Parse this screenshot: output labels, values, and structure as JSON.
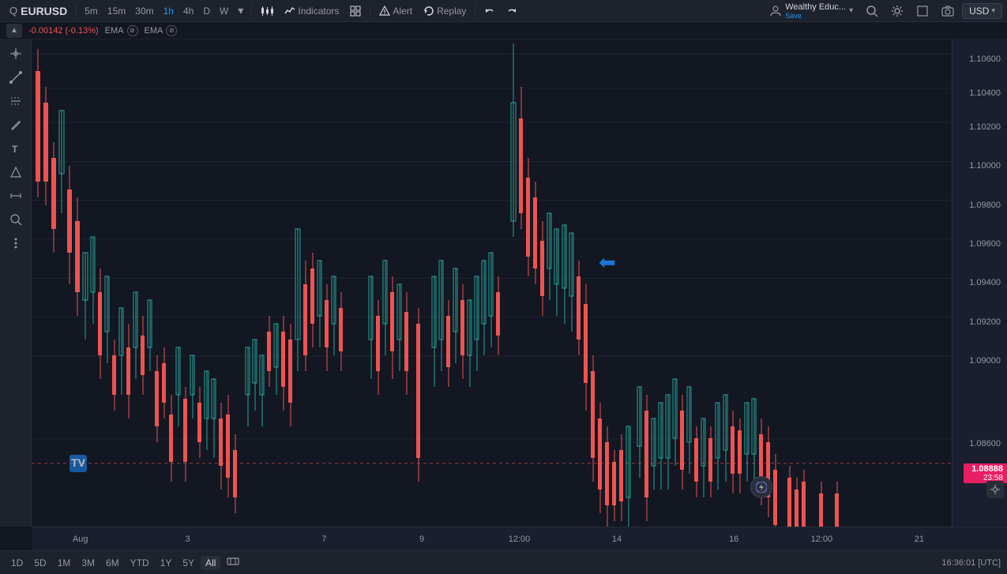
{
  "toolbar": {
    "symbol": "EURUSD",
    "search_icon": "🔍",
    "timeframes": [
      "5m",
      "15m",
      "30m",
      "1h",
      "4h",
      "D",
      "W"
    ],
    "active_timeframe": "1h",
    "chart_type_icon": "📊",
    "indicators_label": "Indicators",
    "layout_icon": "⊞",
    "alert_label": "Alert",
    "replay_label": "Replay",
    "undo_icon": "↩",
    "redo_icon": "↪",
    "user_name": "Wealthy Educ...",
    "user_save": "Save",
    "currency": "USD"
  },
  "price_info": {
    "change": "-0.00142 (-0.13%)",
    "ema1_label": "EMA",
    "ema2_label": "EMA",
    "collapse_icon": "▲"
  },
  "chart": {
    "current_price": "1.08888",
    "current_time": "23:58",
    "arrow_direction": "←",
    "price_levels": [
      {
        "value": "1.10600",
        "y_pct": 3
      },
      {
        "value": "1.10400",
        "y_pct": 10
      },
      {
        "value": "1.10200",
        "y_pct": 17
      },
      {
        "value": "1.10000",
        "y_pct": 25
      },
      {
        "value": "1.09800",
        "y_pct": 33
      },
      {
        "value": "1.09600",
        "y_pct": 41
      },
      {
        "value": "1.09400",
        "y_pct": 49
      },
      {
        "value": "1.09200",
        "y_pct": 57
      },
      {
        "value": "1.09000",
        "y_pct": 65
      },
      {
        "value": "1.08600",
        "y_pct": 82
      }
    ],
    "time_labels": [
      {
        "label": "Aug",
        "x_pct": 5
      },
      {
        "label": "3",
        "x_pct": 16
      },
      {
        "label": "7",
        "x_pct": 30
      },
      {
        "label": "9",
        "x_pct": 40
      },
      {
        "label": "12:00",
        "x_pct": 50
      },
      {
        "label": "14",
        "x_pct": 60
      },
      {
        "label": "16",
        "x_pct": 72
      },
      {
        "label": "12:00",
        "x_pct": 81
      },
      {
        "label": "21",
        "x_pct": 91
      }
    ]
  },
  "bottom_bar": {
    "periods": [
      "1D",
      "5D",
      "1M",
      "3M",
      "6M",
      "YTD",
      "1Y",
      "5Y",
      "All"
    ],
    "active_period": "All",
    "datetime": "16:36:01 [UTC]",
    "compare_icon": "⇄"
  },
  "sidebar_tools": [
    "✛",
    "↗",
    "⟍",
    "╱",
    "⊕",
    "🖊",
    "T",
    "⬡",
    "📐",
    "⋯"
  ],
  "tv_logo": "TV"
}
